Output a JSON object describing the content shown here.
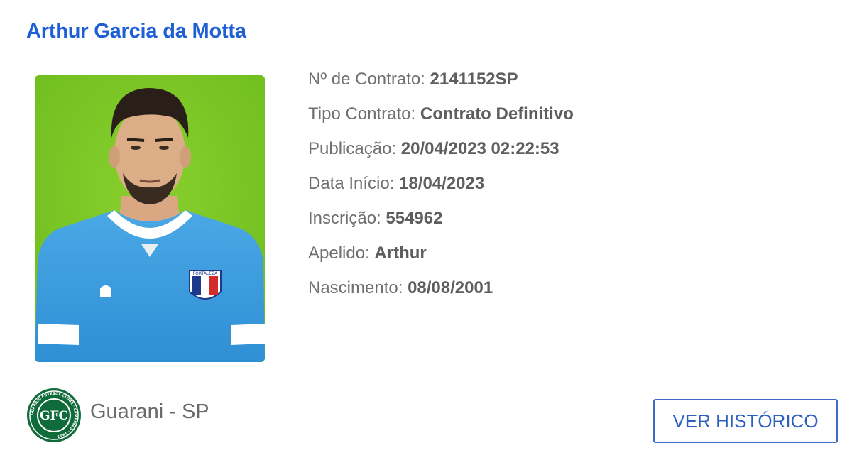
{
  "player": {
    "name": "Arthur Garcia da Motta"
  },
  "details": [
    {
      "label": "Nº de Contrato:",
      "value": "2141152SP"
    },
    {
      "label": "Tipo Contrato:",
      "value": "Contrato Definitivo"
    },
    {
      "label": "Publicação:",
      "value": "20/04/2023 02:22:53"
    },
    {
      "label": "Data Início:",
      "value": "18/04/2023"
    },
    {
      "label": "Inscrição:",
      "value": "554962"
    },
    {
      "label": "Apelido:",
      "value": "Arthur"
    },
    {
      "label": "Nascimento:",
      "value": "08/08/2001"
    }
  ],
  "club": {
    "name": "Guarani - SP",
    "logo_text": "GFC",
    "logo_ring_text": "GUARANI FUTEBOL CLUBE · CAMPINAS · 1911"
  },
  "photo": {
    "background_color": "#7cc825",
    "jersey_color": "#3a9ee0",
    "badge_text": "FORTALEZA"
  },
  "actions": {
    "history_label": "VER HISTÓRICO"
  },
  "colors": {
    "name": "#1f5fd6",
    "button_border": "#3b6cc7",
    "club_green": "#0f6b3a"
  }
}
